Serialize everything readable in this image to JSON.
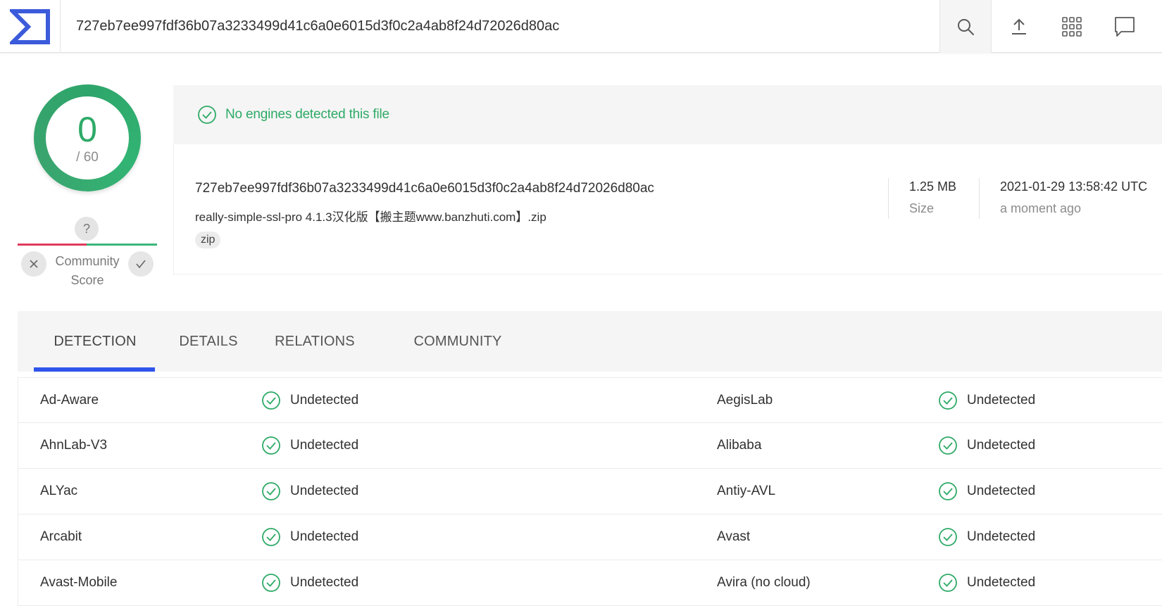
{
  "header": {
    "search_value": "727eb7ee997fdf36b07a3233499d41c6a0e6015d3f0c2a4ab8f24d72026d80ac",
    "icons": [
      "virustotal-logo-icon",
      "search-icon",
      "upload-icon",
      "apps-grid-icon",
      "chat-icon"
    ]
  },
  "score": {
    "detected": "0",
    "total": "/ 60"
  },
  "community": {
    "unknown_mark": "?",
    "label_line1": "Community",
    "label_line2": "Score"
  },
  "summary": {
    "message": "No engines detected this file",
    "hash": "727eb7ee997fdf36b07a3233499d41c6a0e6015d3f0c2a4ab8f24d72026d80ac",
    "file_name": "really-simple-ssl-pro 4.1.3汉化版【搬主题www.banzhuti.com】.zip",
    "tag": "zip",
    "size": "1.25 MB",
    "size_label": "Size",
    "date": "2021-01-29 13:58:42 UTC",
    "date_ago": "a moment ago"
  },
  "tabs": [
    {
      "label": "DETECTION",
      "active": true
    },
    {
      "label": "DETAILS",
      "active": false
    },
    {
      "label": "RELATIONS",
      "active": false
    },
    {
      "label": "COMMUNITY",
      "active": false
    }
  ],
  "results": [
    {
      "left_engine": "Ad-Aware",
      "left_status": "Undetected",
      "right_engine": "AegisLab",
      "right_status": "Undetected"
    },
    {
      "left_engine": "AhnLab-V3",
      "left_status": "Undetected",
      "right_engine": "Alibaba",
      "right_status": "Undetected"
    },
    {
      "left_engine": "ALYac",
      "left_status": "Undetected",
      "right_engine": "Antiy-AVL",
      "right_status": "Undetected"
    },
    {
      "left_engine": "Arcabit",
      "left_status": "Undetected",
      "right_engine": "Avast",
      "right_status": "Undetected"
    },
    {
      "left_engine": "Avast-Mobile",
      "left_status": "Undetected",
      "right_engine": "Avira (no cloud)",
      "right_status": "Undetected"
    }
  ],
  "colors": {
    "accent_blue": "#2f54eb",
    "clean_green": "#2eaa67",
    "malicious_red": "#e03a5a"
  }
}
